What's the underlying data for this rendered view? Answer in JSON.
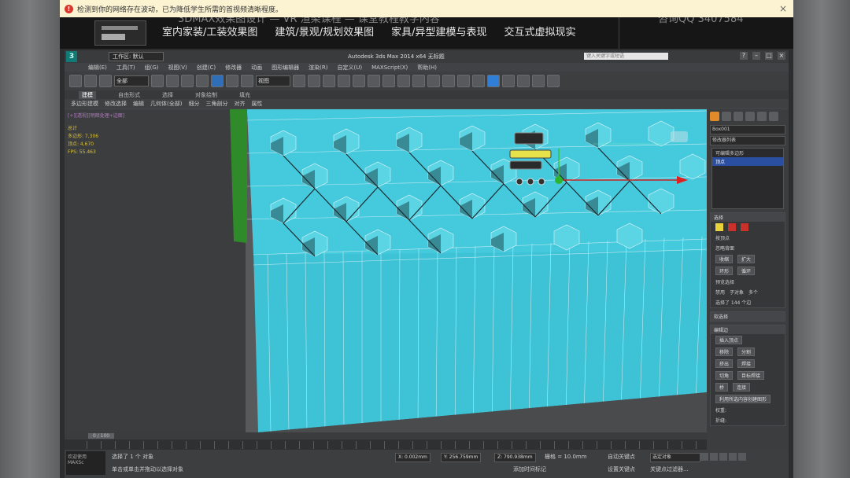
{
  "notification": {
    "text": "检测到你的网络存在波动，已为降低学生所需的首视频清晰程度。",
    "close": "×"
  },
  "banner": {
    "top_line": "3DMAX效果图设计 — VR 渲染课程 — 课堂教程教学内容",
    "top_right": "咨询QQ 3407584",
    "categories": [
      "室内家装/工装效果图",
      "建筑/景观/规划效果图",
      "家具/异型建模与表现",
      "交互式虚拟现实"
    ]
  },
  "app": {
    "logo": "3",
    "workspace": "工作区: 默认",
    "title": "Autodesk 3ds Max 2014 x64    无标题",
    "search_placeholder": "键入关键字或短语",
    "win_buttons": [
      "?",
      "–",
      "□",
      "×"
    ],
    "menu": [
      "编辑(E)",
      "工具(T)",
      "组(G)",
      "视图(V)",
      "创建(C)",
      "修改器",
      "动画",
      "图形编辑器",
      "渲染(R)",
      "自定义(U)",
      "MAXScript(X)",
      "帮助(H)"
    ],
    "toolbar_select": "全部",
    "toolbar_view": "视图",
    "ribbon_tabs": [
      "建模",
      "自由形式",
      "选择",
      "对象绘制",
      "填充"
    ],
    "ribbon_active": 0,
    "ribbon_sub": [
      "多边形建模",
      "修改选择",
      "编辑",
      "几何体(全部)",
      "细分",
      "三角剖分",
      "对齐",
      "属性"
    ]
  },
  "viewport": {
    "label": "[+][透视][明暗处理+边面]",
    "stats": [
      "总计",
      "多边形: 7,306",
      "顶点: 4,670",
      "",
      "FPS: 55.463"
    ]
  },
  "command_panel": {
    "name_field": "Box001",
    "modifier_list": "修改器列表",
    "stack": [
      "可编辑多边形",
      "顶点"
    ],
    "selection": {
      "title": "选择",
      "by_vertex": "按顶点",
      "ignore_backfacing": "忽略背面",
      "shrink": "收缩",
      "grow": "扩大",
      "ring": "环形",
      "loop": "循环",
      "preview_label": "预览选择",
      "preview_options": [
        "禁用",
        "子对象",
        "多个"
      ],
      "selected_text": "选择了 144 个边"
    },
    "soft_selection": "软选择",
    "edit_edges": {
      "title": "编辑边",
      "insert_vertex": "插入顶点",
      "remove": "移除",
      "split": "分割",
      "extrude": "挤出",
      "weld": "焊接",
      "chamfer": "切角",
      "target_weld": "目标焊接",
      "bridge": "桥",
      "connect": "连接",
      "create_shape": "利用所选内容创建图形",
      "weight": "权重:",
      "crease": "折缝:"
    }
  },
  "timeline": {
    "slider_text": "0 / 100",
    "ticks": [
      "0",
      "10",
      "20",
      "30",
      "40",
      "50",
      "60",
      "70",
      "80",
      "90",
      "100"
    ]
  },
  "status": {
    "welcome": "欢迎使用 MAXSc",
    "line1": "选择了 1 个 对象",
    "line2": "单击或单击并拖动以选择对象",
    "x": "X: 0.002mm",
    "y": "Y: 256.759mm",
    "z": "Z: 790.938mm",
    "grid": "栅格 = 10.0mm",
    "auto_key": "自动关键点",
    "selected_obj": "选定对象",
    "set_key": "设置关键点",
    "key_filter": "关键点过滤器...",
    "add_time_tag": "添加时间标记"
  },
  "colors": {
    "mesh": "#3ec2d6",
    "mesh_dark": "#2aa8bc",
    "wire": "#d9f2f6",
    "accent": "#2f7fd8"
  }
}
